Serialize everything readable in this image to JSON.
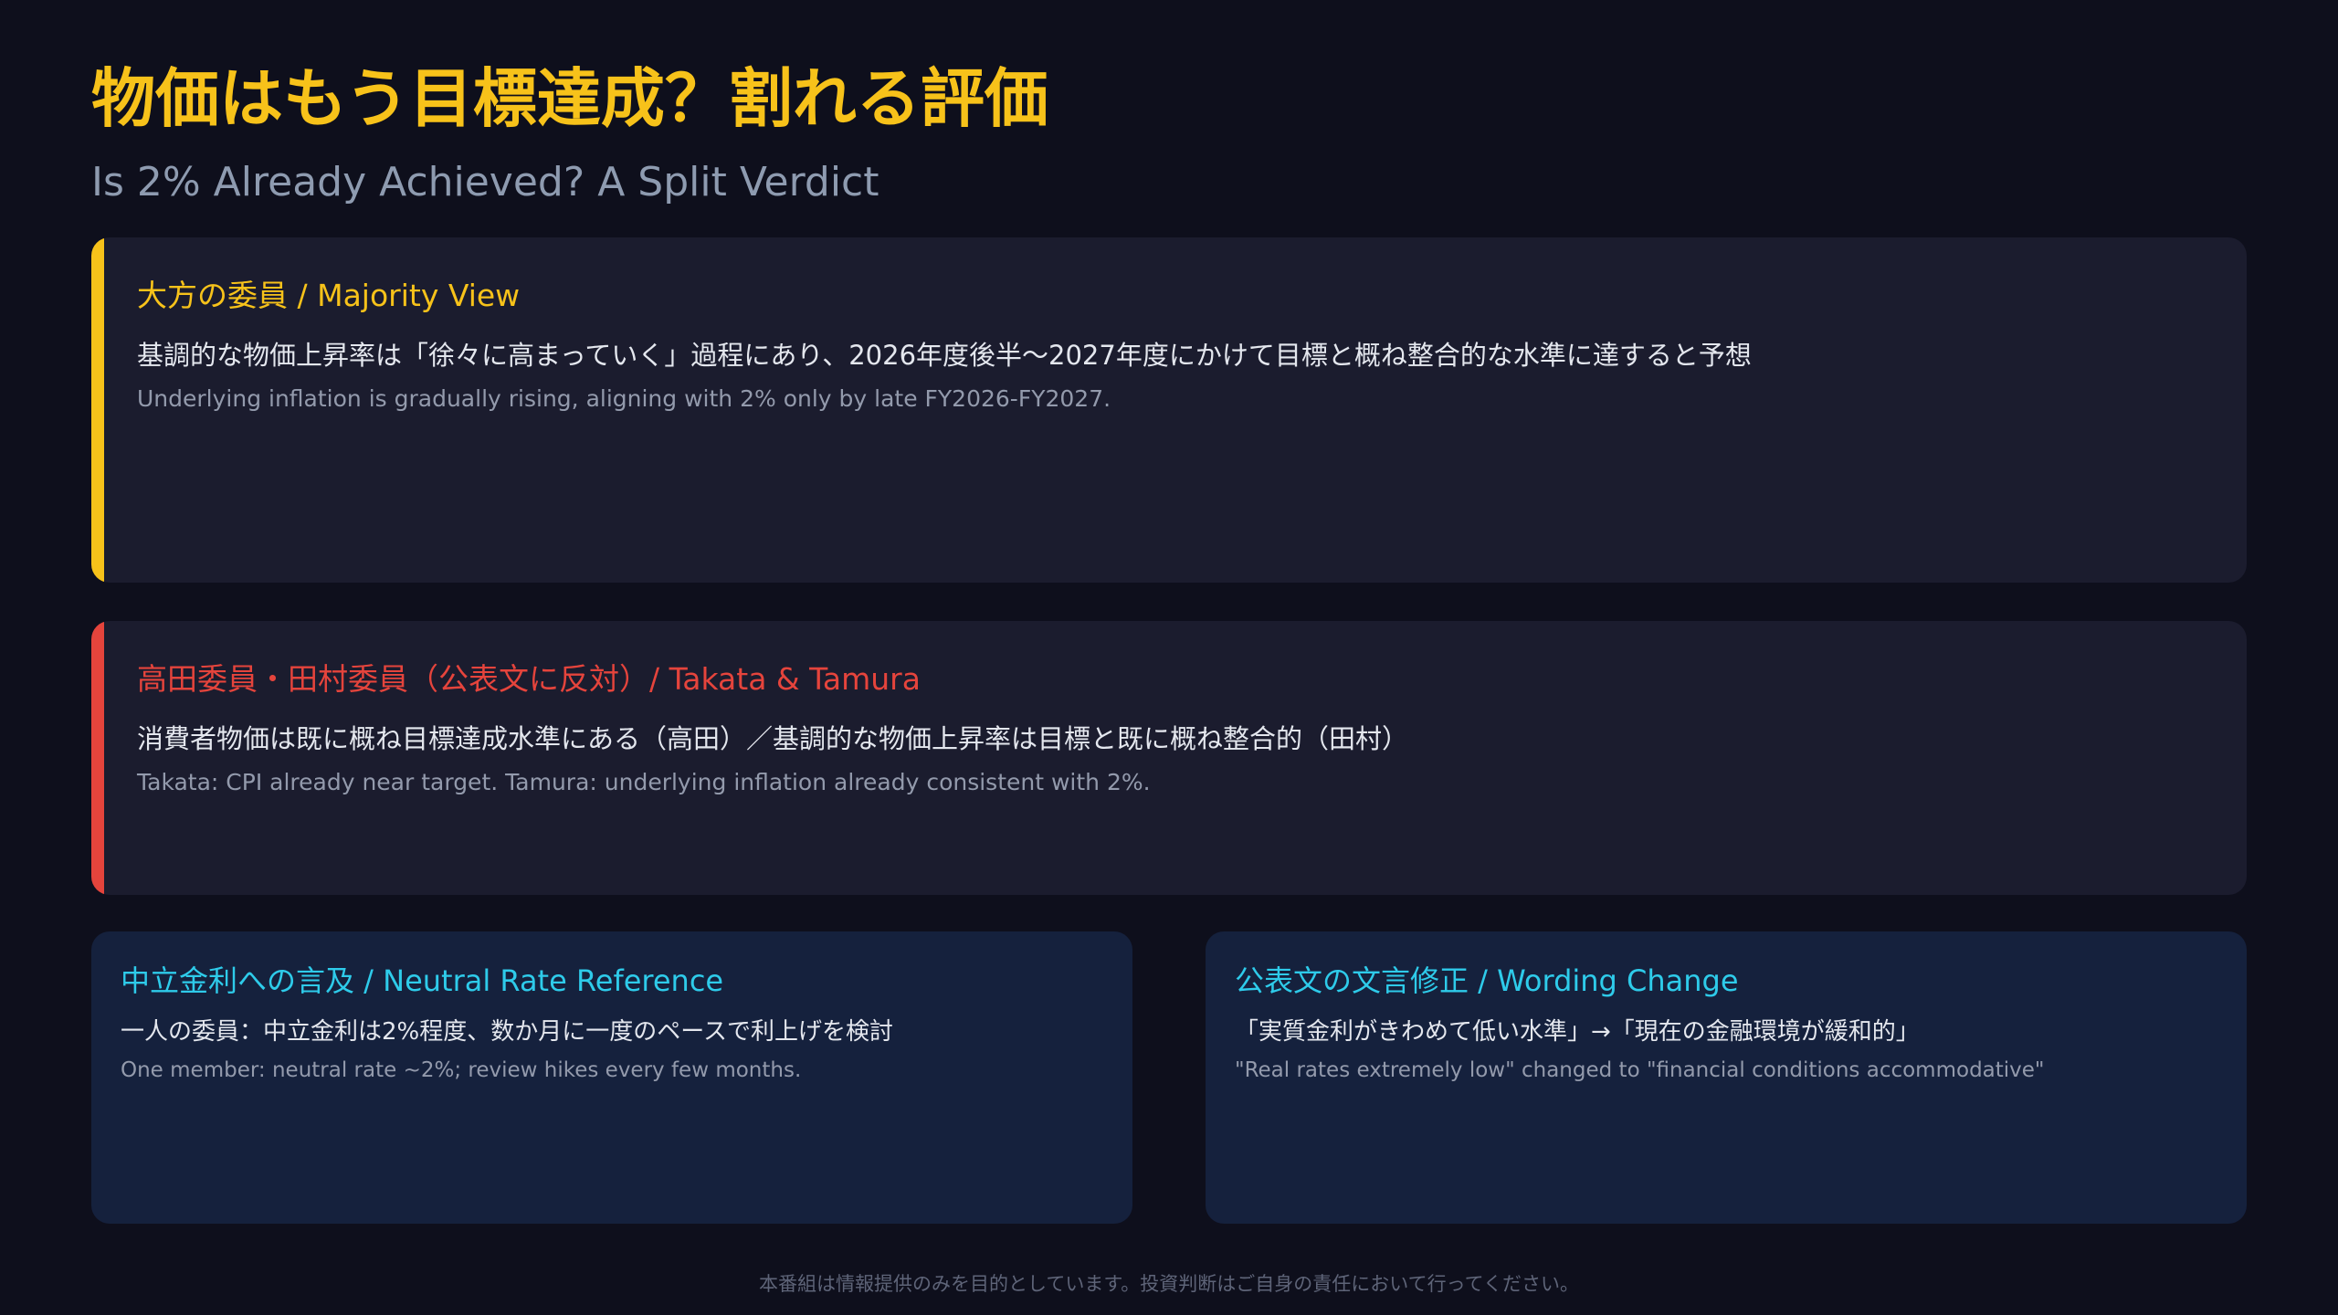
{
  "header": {
    "title": "物価はもう目標達成？割れる評価",
    "subtitle": "Is 2% Already Achieved? A Split Verdict"
  },
  "majority": {
    "heading": "大方の委員 / Majority View",
    "text_jp": "基調的な物価上昇率は「徐々に高まっていく」過程にあり、2026年度後半〜2027年度にかけて目標と概ね整合的な水準に達すると予想",
    "text_en": "Underlying inflation is gradually rising, aligning with 2% only by late FY2026-FY2027.",
    "accent_color": "#f7c21a"
  },
  "dissent": {
    "heading": "高田委員・田村委員（公表文に反対）/ Takata & Tamura",
    "text_jp": "消費者物価は既に概ね目標達成水準にある（高田）／基調的な物価上昇率は目標と既に概ね整合的（田村）",
    "text_en": "Takata: CPI already near target. Tamura: underlying inflation already consistent with 2%.",
    "accent_color": "#e5443c"
  },
  "neutral_rate": {
    "heading": "中立金利への言及 / Neutral Rate Reference",
    "text_jp": "一人の委員：中立金利は2%程度、数か月に一度のペースで利上げを検討",
    "text_en": "One member: neutral rate ~2%; review hikes every few months.",
    "accent_color": "#2ecbea"
  },
  "wording_change": {
    "heading": "公表文の文言修正 / Wording Change",
    "text_jp": "「実質金利がきわめて低い水準」→「現在の金融環境が緩和的」",
    "text_en": "\"Real rates extremely low\" changed to \"financial conditions accommodative\"",
    "accent_color": "#2ecbea"
  },
  "footer": {
    "disclaimer": "本番組は情報提供のみを目的としています。投資判断はご自身の責任において行ってください。"
  }
}
